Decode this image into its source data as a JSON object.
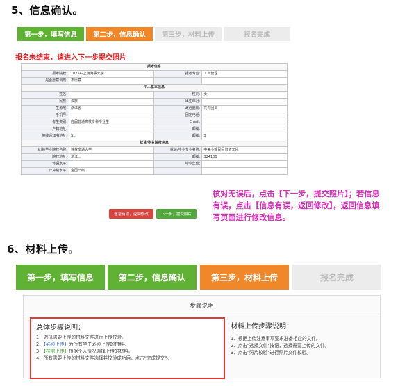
{
  "section5": {
    "heading": "5、信息确认。",
    "steps": [
      "第一步，填写信息",
      "第二步，信息确认",
      "第三步，材料上传",
      "报名完成"
    ],
    "notice": "报名未结束，请进入下一步提交照片",
    "table": {
      "sec_apply": "报考信息",
      "r1": [
        "报考院校:",
        "10254-上海海事大学",
        "报考专业:",
        "工商管理"
      ],
      "r2": [
        "是否愿意调剂:",
        "不愿意",
        "",
        ""
      ],
      "sec_personal": "个人基本信息",
      "r3": [
        "姓名:",
        "",
        "性别:",
        "女"
      ],
      "r4": [
        "民族:",
        "汉族",
        "出生年月:",
        ""
      ],
      "r5": [
        "生源地:",
        "浙江省",
        "政治面貌:",
        "共青团员"
      ],
      "r6": [
        "手机号:",
        "",
        "固定电话:",
        ""
      ],
      "r7": [
        "考生类别:",
        "应届普通高校专科毕业生",
        "Email:",
        ""
      ],
      "r8": [
        "户籍地址:",
        "",
        "邮编:",
        ""
      ],
      "r9": [
        "接收通知书地址:",
        "S...",
        "邮编:",
        "3"
      ],
      "sec_grad": "就读/毕业院校信息",
      "r10": [
        "就读/毕业院校名称:",
        "徐攸交通大学",
        "就读/毕业专业名称:",
        "中美小额民间借贷文化"
      ],
      "r11": [
        "院校地址:",
        "浙江...",
        "邮编:",
        "324100"
      ],
      "r12": [
        "外语水平:",
        "",
        "毕业年份:",
        ""
      ],
      "r13": [
        "计算机水平:",
        "全国一级",
        "",
        ""
      ]
    },
    "btn_modify": "信息有误，返回修改",
    "btn_next": "下一步，提交照片",
    "annotation": [
      "核对无误后，点击【下一步，提交照片】；若信息",
      "有误，点击【信息有误，返回修改】，返回信息填",
      "写页面进行修改信息。"
    ]
  },
  "section6": {
    "heading": "6、材料上传。",
    "steps": [
      "第一步，填写信息",
      "第二步，信息确认",
      "第三步，材料上传",
      "报名完成"
    ],
    "panel_title": "步骤说明",
    "left_title": "总体步骤说明：",
    "left_items": [
      {
        "num": "1、",
        "tag": "",
        "text": "选择需要上传的材料文件进行上传校验。"
      },
      {
        "num": "2、",
        "tag": "【必须上传】",
        "text": "为所有学生必须上传的材料。"
      },
      {
        "num": "3、",
        "tag": "【按需上传】",
        "text": "根据个人情况选择上传的材料。"
      },
      {
        "num": "4、",
        "tag": "",
        "text": "所有需要上传的材料文件选择并校验成功后，点击\"完成提交\"。"
      }
    ],
    "right_title": "材料上传步骤说明：",
    "right_items": [
      "1、根据上传注意事项要求准备相应的文件。",
      "2、点击\"选择文件\"按钮，选择需要上传的文件。",
      "3、点击\"照片校验\"进行照片文件校验。"
    ]
  },
  "colors": {
    "green": "#5fb233",
    "orange": "#f0882a",
    "red": "#e02020",
    "pink": "#d631b6"
  }
}
